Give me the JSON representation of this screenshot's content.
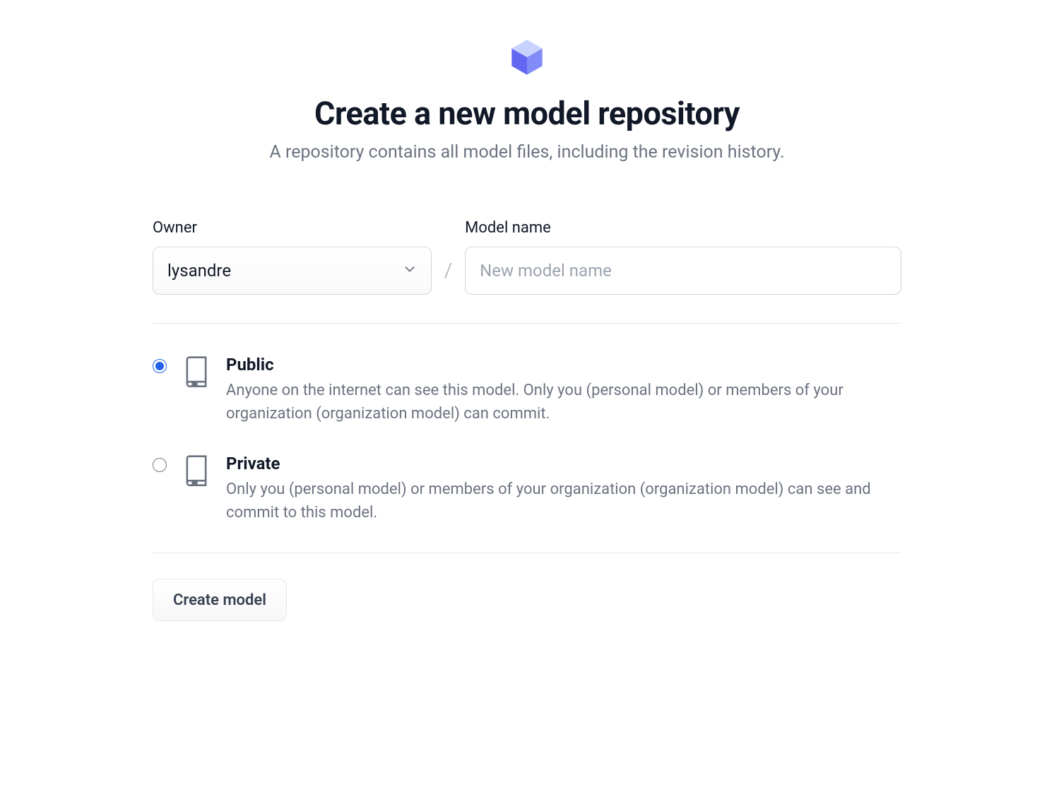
{
  "header": {
    "title": "Create a new model repository",
    "subtitle": "A repository contains all model files, including the revision history."
  },
  "form": {
    "owner": {
      "label": "Owner",
      "value": "lysandre"
    },
    "separator": "/",
    "model_name": {
      "label": "Model name",
      "placeholder": "New model name",
      "value": ""
    }
  },
  "visibility": {
    "options": [
      {
        "title": "Public",
        "description": "Anyone on the internet can see this model. Only you (personal model) or members of your organization (organization model) can commit.",
        "selected": true
      },
      {
        "title": "Private",
        "description": "Only you (personal model) or members of your organization (organization model) can see and commit to this model.",
        "selected": false
      }
    ]
  },
  "actions": {
    "create_label": "Create model"
  }
}
